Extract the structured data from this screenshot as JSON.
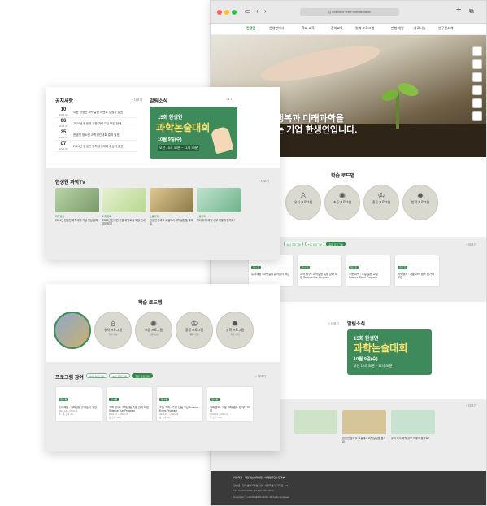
{
  "browser": {
    "address": "Q Search or enter website name",
    "nav": [
      "한생연",
      "한생연에서..",
      "학교 교육",
      "참여교육",
      "원격 프로그램",
      "판형 개발",
      "자료나눔",
      "연구진소개"
    ]
  },
  "hero": {
    "line1": "행복과 미래과학을",
    "line2": "는 기업 한생연입니다."
  },
  "notice": {
    "title": "공지사항",
    "more": "+ 더보기",
    "items": [
      {
        "day": "10",
        "ym": "2024.09",
        "text": "여름 한생연 과학실험 이벤트 당첨자 발표"
      },
      {
        "day": "06",
        "ym": "2024.09",
        "text": "2024년 한생연 가을 과학교실 모집 안내"
      },
      {
        "day": "25",
        "ym": "2024.08",
        "text": "한생연 청소년 과학경진대회 결과 발표"
      },
      {
        "day": "07",
        "ym": "2024.08",
        "text": "2024년 한생연 과학탐구대회 수상자 발표"
      }
    ]
  },
  "alert": {
    "title": "알림소식",
    "dots": "● ● ●"
  },
  "banner": {
    "line1": "15회 한생연",
    "line2": "과학논술대회",
    "line3": "10월 9일(수)",
    "line4": "오전 10시 30분 ~ 11시 30분"
  },
  "tv": {
    "title": "한생연 과학TV",
    "more": "+ 더보기",
    "cards": [
      {
        "tag": "과학교육",
        "text": "2024년 한생연 과학대회 기념 영상 강좌"
      },
      {
        "tag": "과학교육",
        "text": "2024년 한생연 가을 과학교실 모집 안내 미리보기"
      },
      {
        "tag": "초등과학",
        "text": "한생연 방과후 교실에서 과학실험을 즐겨요"
      },
      {
        "tag": "초등과학",
        "text": "우리 아이 과학 공부 어떻게 할까요?"
      }
    ]
  },
  "roadmap": {
    "title": "학습 로드맵",
    "items": [
      {
        "icon": "♙",
        "label": "유치 프로그램",
        "sub": "유아 대상"
      },
      {
        "icon": "✺",
        "label": "초등 프로그램",
        "sub": "초등 대상"
      },
      {
        "icon": "♔",
        "label": "중등 프로그램",
        "sub": "중등 대상"
      },
      {
        "icon": "✹",
        "label": "방학 프로그램",
        "sub": "특강 과정"
      }
    ]
  },
  "program": {
    "title": "프로그램 참여",
    "more": "+ 더보기",
    "tabs": [
      "유아 프로그램",
      "초등 프로그램",
      "중등 프로그램"
    ],
    "cards": [
      {
        "tag": "접수중",
        "text": "유아체험 : 과학실험 유아놀이 개강",
        "meta1": "2024.10 ~ 2024.11",
        "meta2": "화 · 목 오후 4시"
      },
      {
        "tag": "접수중",
        "text": "과학 탐구 : 과학실험 특별 강좌 모집 Science Fun Program",
        "meta1": "2024.10 ~ 2024.12",
        "meta2": "토 오전 10시"
      },
      {
        "tag": "접수중",
        "text": "초등 과학 : 주말 실험 교실 Science Event Program",
        "meta1": "2024.10 ~ 2024.12",
        "meta2": "토 오후 2시"
      },
      {
        "tag": "접수중",
        "text": "과학캠프 : 가을 과학 캠프 참가자 모집",
        "meta1": "2024.10 ~ 2024.11",
        "meta2": "일 오전 10시"
      }
    ]
  },
  "footer": {
    "links": "이용약관 · 개인정보처리방침 · 이메일무단수집거부",
    "line1": "한생연 · 한국생명과학연구원 · 서울특별시 과학로 123",
    "line2": "TEL 02-000-0000 · FAX 02-000-0000",
    "copyright": "Copyright ⓒ HANSAENGYEON. All rights reserved."
  }
}
